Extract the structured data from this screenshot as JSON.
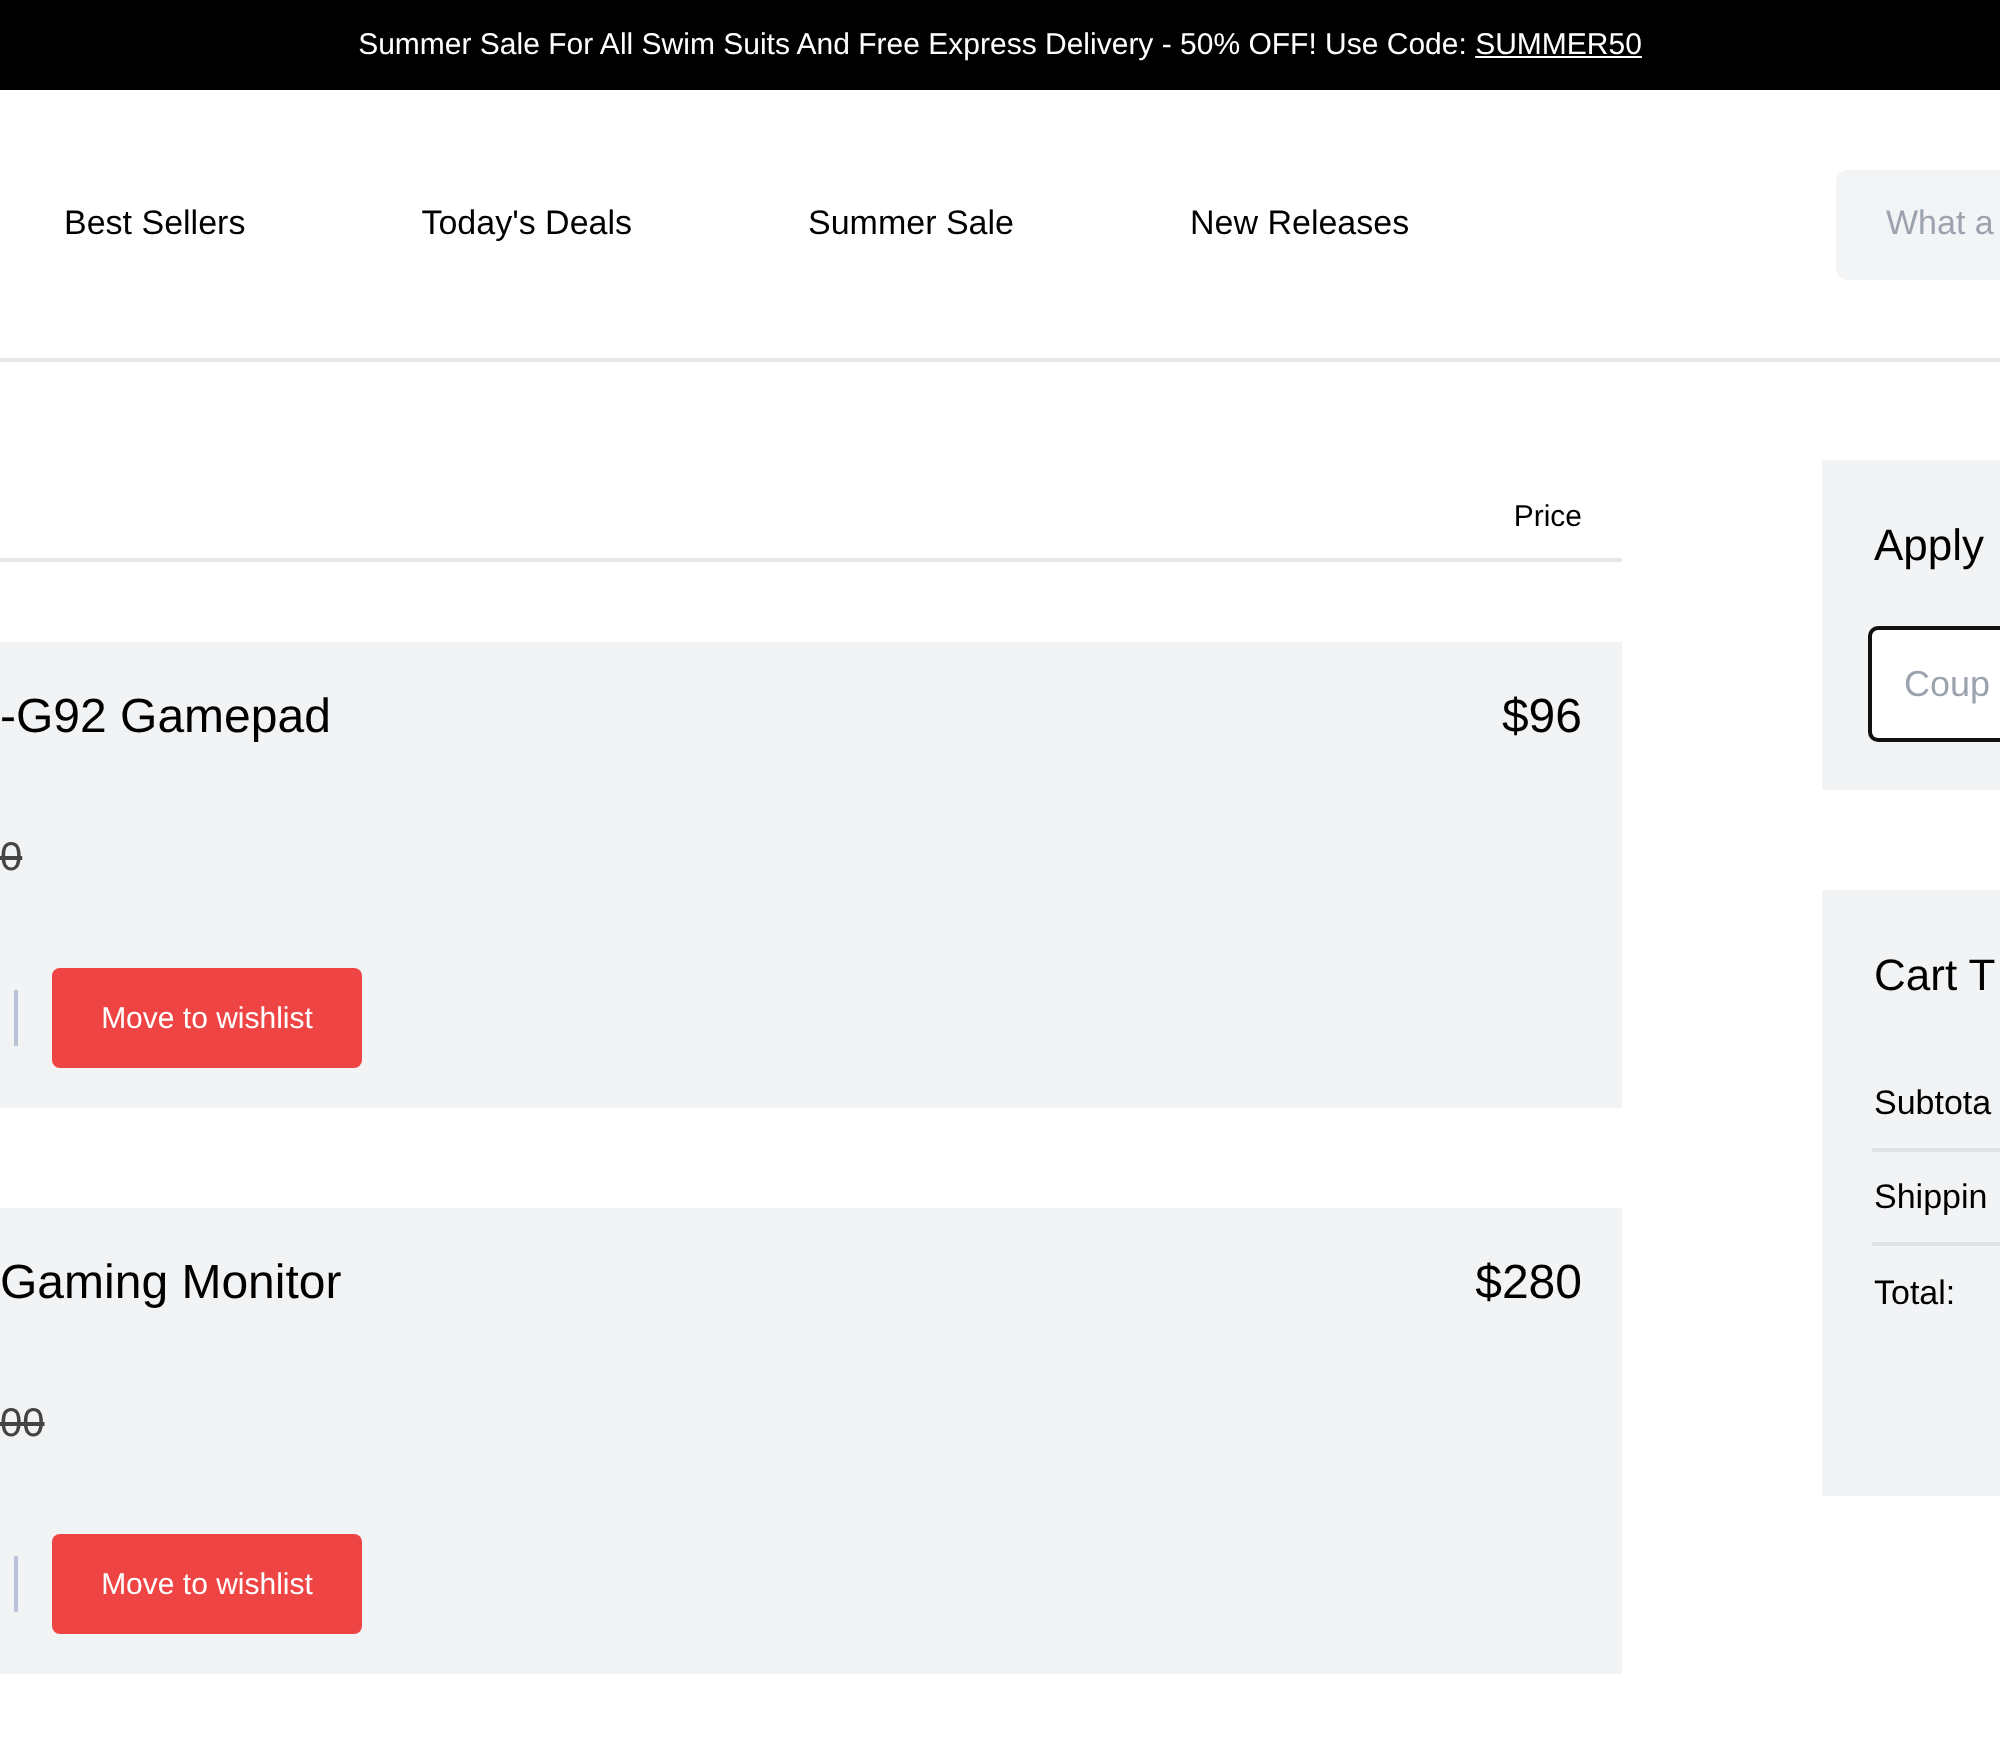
{
  "promo_banner": {
    "text": "Summer Sale For All Swim Suits And Free Express Delivery - 50% OFF! Use Code:",
    "code": "SUMMER50"
  },
  "nav": {
    "links": [
      "Best Sellers",
      "Today's Deals",
      "Summer Sale",
      "New Releases"
    ],
    "search": {
      "placeholder": "What a"
    }
  },
  "cart": {
    "price_column": "Price",
    "items": [
      {
        "name": "-G92 Gamepad",
        "price": "$96",
        "old_price": "0",
        "action": "Move to wishlist"
      },
      {
        "name": "Gaming Monitor",
        "price": "$280",
        "old_price": "00",
        "action": "Move to wishlist"
      }
    ]
  },
  "coupon": {
    "title": "Apply",
    "placeholder": "Coup"
  },
  "totals": {
    "title": "Cart T",
    "rows": [
      "Subtota",
      "Shippin",
      "Total:"
    ]
  }
}
